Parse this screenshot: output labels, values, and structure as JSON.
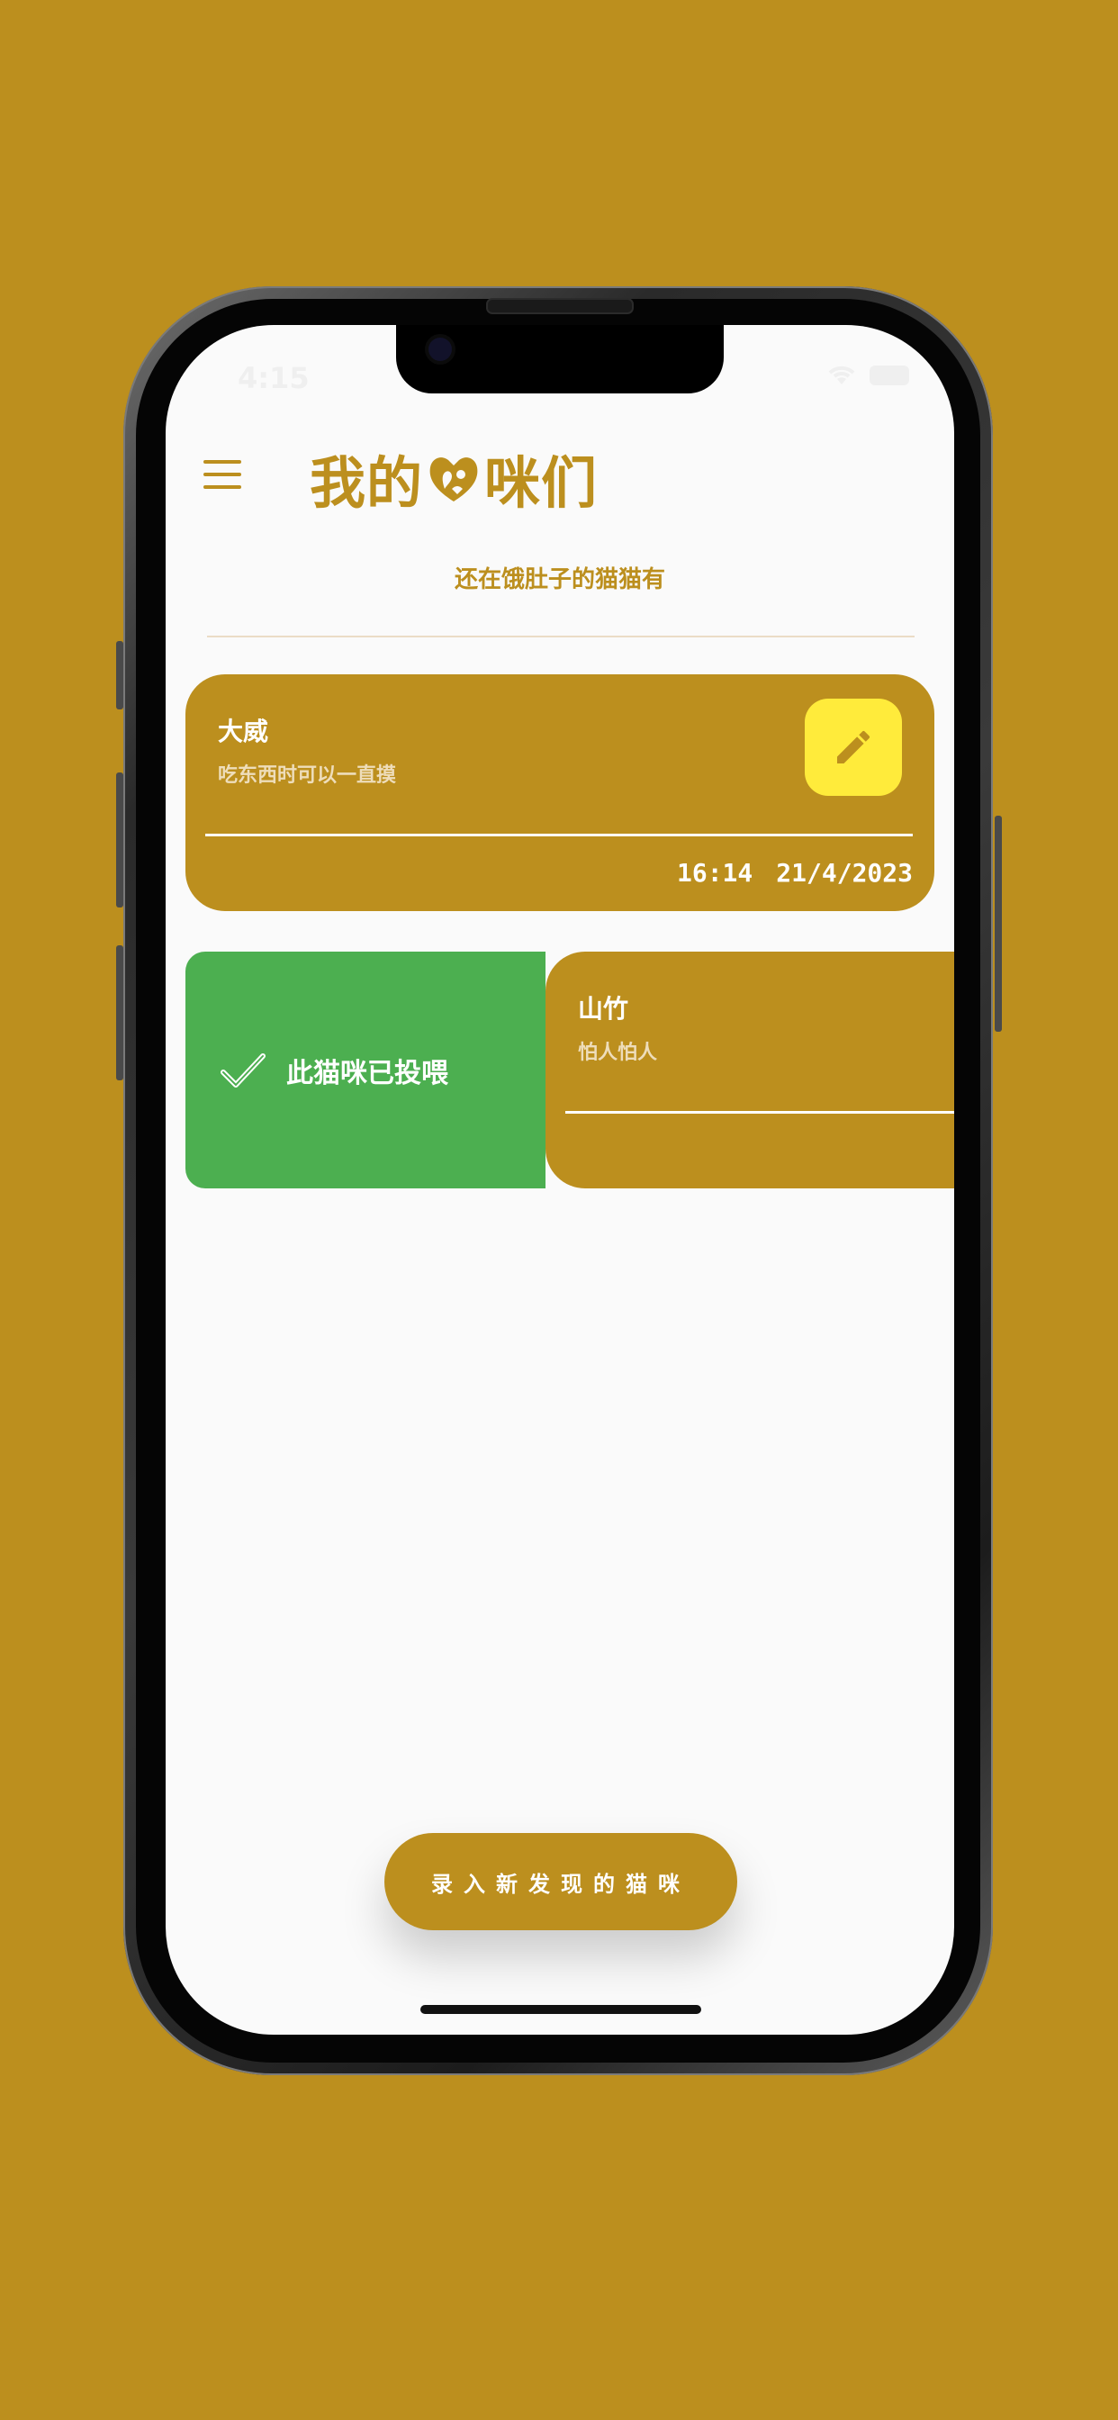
{
  "status_bar": {
    "time": "4:15"
  },
  "header": {
    "title_part1": "我的",
    "title_part2": "咪们",
    "subtitle": "还在饿肚子的猫猫有"
  },
  "cats": [
    {
      "name": "大威",
      "note": "吃东西时可以一直摸",
      "time": "16:14",
      "date": "21/4/2023"
    },
    {
      "name": "山竹",
      "note": "怕人怕人"
    }
  ],
  "swipe_action": {
    "label": "此猫咪已投喂"
  },
  "add_button": {
    "label": "录入新发现的猫咪"
  },
  "colors": {
    "background": "#BC8F1E",
    "primary": "#BC8F1E",
    "edit_button": "#FFEB3B",
    "fed_action": "#4CAF50",
    "screen": "#FAFAFA"
  },
  "icons": {
    "menu": "hamburger-menu-icon",
    "edit": "pencil-icon",
    "fed": "checkmark-icon",
    "title_heart": "cat-heart-icon"
  }
}
